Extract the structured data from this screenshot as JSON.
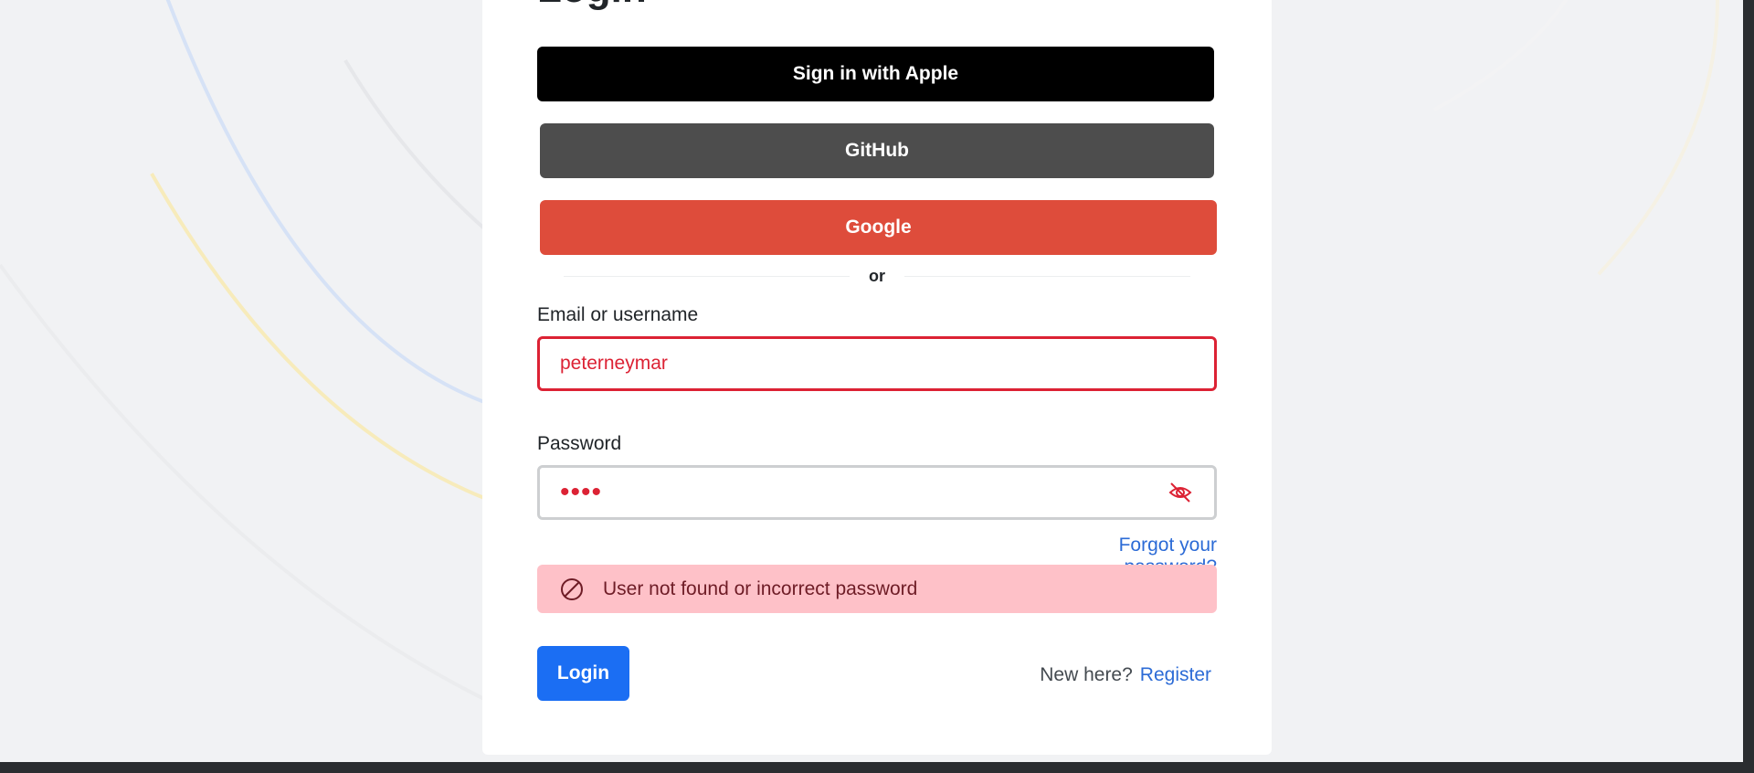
{
  "page": {
    "title": "Login"
  },
  "social": {
    "apple_label": "Sign in with Apple",
    "github_label": "GitHub",
    "google_label": "Google"
  },
  "divider": {
    "text": "or"
  },
  "form": {
    "email_label": "Email or username",
    "email_value": "peterneymar",
    "password_label": "Password",
    "password_masked": "••••",
    "forgot_link": "Forgot your password?",
    "error_message": "User not found or incorrect password",
    "login_button": "Login",
    "new_here_text": "New here?",
    "register_link": "Register"
  },
  "colors": {
    "primary": "#1b6ef3",
    "danger": "#dc2234",
    "alert_background": "#fec1c8",
    "apple": "#000000",
    "github": "#4d4d4d",
    "google": "#de4c3b",
    "link": "#2c6bd6"
  },
  "icons": {
    "password_toggle": "eye-slash-icon",
    "alert": "ban-icon"
  }
}
